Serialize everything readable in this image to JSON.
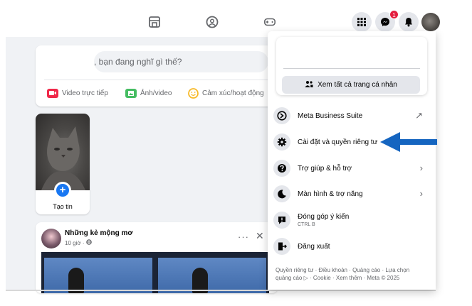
{
  "navbar": {
    "icons": [
      "marketplace-icon",
      "groups-icon",
      "gaming-icon"
    ],
    "menu_icon": "grid-menu-icon",
    "messenger_icon": "messenger-icon",
    "messenger_badge": "1",
    "notification_icon": "bell-icon"
  },
  "composer": {
    "placeholder": ", bạn đang nghĩ gì thế?",
    "actions": [
      {
        "label": "Video trực tiếp",
        "icon": "live-video-icon",
        "color": "#f02849"
      },
      {
        "label": "Ảnh/video",
        "icon": "photo-icon",
        "color": "#45bd62"
      },
      {
        "label": "Cảm xúc/hoạt động",
        "icon": "feeling-icon",
        "color": "#f7b928"
      }
    ]
  },
  "story": {
    "label": "Tạo tin",
    "plus": "+"
  },
  "post": {
    "author": "Những kẻ mộng mơ",
    "time": "10 giờ · ",
    "more": "···",
    "close": "✕"
  },
  "menu": {
    "see_all_profiles": "Xem tất cả trang cá nhân",
    "items": [
      {
        "label": "Meta Business Suite",
        "sub": "",
        "icon": "business-suite-icon",
        "right": "↗"
      },
      {
        "label": "Cài đặt và quyền riêng tư",
        "sub": "",
        "icon": "gear-icon",
        "right": "›"
      },
      {
        "label": "Trợ giúp & hỗ trợ",
        "sub": "",
        "icon": "help-icon",
        "right": "›"
      },
      {
        "label": "Màn hình & trợ năng",
        "sub": "",
        "icon": "moon-icon",
        "right": "›"
      },
      {
        "label": "Đóng góp ý kiến",
        "sub": "CTRL B",
        "icon": "feedback-icon",
        "right": ""
      },
      {
        "label": "Đăng xuất",
        "sub": "",
        "icon": "logout-icon",
        "right": ""
      }
    ],
    "footer": "Quyền riêng tư · Điều khoản · Quảng cáo · Lựa chọn quảng cáo ▷ · Cookie · Xem thêm · Meta © 2025"
  },
  "colors": {
    "accent": "#1877f2",
    "annotation_arrow": "#1565c0",
    "badge": "#e41e3f"
  }
}
